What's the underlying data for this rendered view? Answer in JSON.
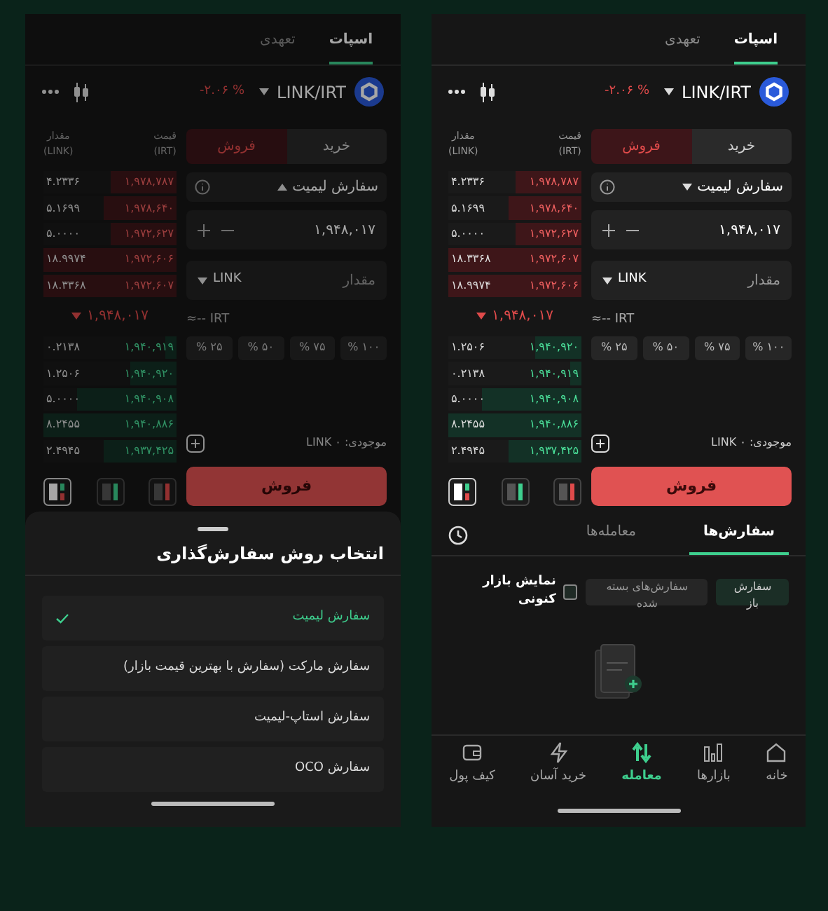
{
  "left_phone": {
    "trade": {
      "tabs": [
        {
          "label": "اسپات",
          "selected": true
        },
        {
          "label": "تعهدی",
          "selected": false
        }
      ],
      "pair": "LINK/IRT",
      "change": "-۲.۰۶ %",
      "side_tabs": [
        {
          "label": "خرید",
          "kind": "buy",
          "selected": false
        },
        {
          "label": "فروش",
          "kind": "sell",
          "selected": true
        }
      ],
      "book_headers": [
        {
          "label": "قیمت",
          "unit": "(IRT)"
        },
        {
          "label": "مقدار",
          "unit": "(LINK)"
        }
      ],
      "asks": [
        {
          "price": "۱,۹۷۸,۷۸۷",
          "amount": "۴.۲۳۳۶",
          "level": 0.5
        },
        {
          "price": "۱,۹۷۸,۶۴۰",
          "amount": "۵.۱۶۹۹",
          "level": 0.55
        },
        {
          "price": "۱,۹۷۲,۶۲۷",
          "amount": "۵.۰۰۰۰",
          "level": 0.5
        },
        {
          "price": "۱,۹۷۲,۶۰۶",
          "amount": "۱۸.۹۹۷۴",
          "level": 1
        },
        {
          "price": "۱,۹۷۲,۶۰۷",
          "amount": "۱۸.۳۳۶۸",
          "level": 1
        }
      ],
      "last_price": "۱,۹۴۸,۰۱۷",
      "irt_estimate": "≈-- IRT",
      "bids": [
        {
          "price": "۱,۹۴۰,۹۱۹",
          "amount": "۰.۲۱۳۸",
          "level": 0.08
        },
        {
          "price": "۱,۹۴۰,۹۲۰",
          "amount": "۱.۲۵۰۶",
          "level": 0.35
        },
        {
          "price": "۱,۹۴۰,۹۰۸",
          "amount": "۵.۰۰۰۰",
          "level": 0.75
        },
        {
          "price": "۱,۹۴۰,۸۸۶",
          "amount": "۸.۲۴۵۵",
          "level": 1
        },
        {
          "price": "۱,۹۳۷,۴۲۵",
          "amount": "۲.۴۹۴۵",
          "level": 0.55
        }
      ],
      "order_type": {
        "label": "سفارش لیمیت",
        "expanded": true
      },
      "price_value": "۱,۹۴۸,۰۱۷",
      "amount_placeholder": "مقدار",
      "amount_unit": "LINK",
      "percents": [
        "۱۰۰ %",
        "۷۵ %",
        "۵۰ %",
        "۲۵ %"
      ],
      "balance_label": "موجودی:",
      "balance_value": "LINK ۰",
      "submit": "فروش"
    },
    "sheet": {
      "title": "انتخاب روش سفارش‌گذاری",
      "options": [
        {
          "label": "سفارش لیمیت",
          "selected": true
        },
        {
          "label": "سفارش مارکت (سفارش با بهترین قیمت بازار)",
          "selected": false
        },
        {
          "label": "سفارش استاپ-لیمیت",
          "selected": false
        },
        {
          "label": "سفارش OCO",
          "selected": false
        }
      ]
    }
  },
  "right_phone": {
    "trade": {
      "tabs": [
        {
          "label": "اسپات",
          "selected": true
        },
        {
          "label": "تعهدی",
          "selected": false
        }
      ],
      "pair": "LINK/IRT",
      "change": "-۲.۰۶ %",
      "side_tabs": [
        {
          "label": "خرید",
          "kind": "buy",
          "selected": false
        },
        {
          "label": "فروش",
          "kind": "sell",
          "selected": true
        }
      ],
      "book_headers": [
        {
          "label": "قیمت",
          "unit": "(IRT)"
        },
        {
          "label": "مقدار",
          "unit": "(LINK)"
        }
      ],
      "asks": [
        {
          "price": "۱,۹۷۸,۷۸۷",
          "amount": "۴.۲۳۳۶",
          "level": 0.5
        },
        {
          "price": "۱,۹۷۸,۶۴۰",
          "amount": "۵.۱۶۹۹",
          "level": 0.55
        },
        {
          "price": "۱,۹۷۲,۶۲۷",
          "amount": "۵.۰۰۰۰",
          "level": 0.5
        },
        {
          "price": "۱,۹۷۲,۶۰۷",
          "amount": "۱۸.۳۳۶۸",
          "level": 1
        },
        {
          "price": "۱,۹۷۲,۶۰۶",
          "amount": "۱۸.۹۹۷۴",
          "level": 1
        }
      ],
      "last_price": "۱,۹۴۸,۰۱۷",
      "irt_estimate": "≈-- IRT",
      "bids": [
        {
          "price": "۱,۹۴۰,۹۲۰",
          "amount": "۱.۲۵۰۶",
          "level": 0.35
        },
        {
          "price": "۱,۹۴۰,۹۱۹",
          "amount": "۰.۲۱۳۸",
          "level": 0.08
        },
        {
          "price": "۱,۹۴۰,۹۰۸",
          "amount": "۵.۰۰۰۰",
          "level": 0.75
        },
        {
          "price": "۱,۹۴۰,۸۸۶",
          "amount": "۸.۲۴۵۵",
          "level": 1
        },
        {
          "price": "۱,۹۳۷,۴۲۵",
          "amount": "۲.۴۹۴۵",
          "level": 0.55
        }
      ],
      "order_type": {
        "label": "سفارش لیمیت",
        "expanded": false
      },
      "price_value": "۱,۹۴۸,۰۱۷",
      "amount_placeholder": "مقدار",
      "amount_unit": "LINK",
      "percents": [
        "۱۰۰ %",
        "۷۵ %",
        "۵۰ %",
        "۲۵ %"
      ],
      "balance_label": "موجودی:",
      "balance_value": "LINK ۰",
      "submit": "فروش"
    },
    "orders": {
      "tabs": [
        {
          "label": "سفارش‌ها",
          "selected": true
        },
        {
          "label": "معامله‌ها",
          "selected": false
        }
      ],
      "filters": [
        {
          "label": "سفارش باز",
          "selected": true
        },
        {
          "label": "سفارش‌های بسته شده",
          "selected": false
        }
      ],
      "current_market": {
        "label": "نمایش بازار کنونی",
        "checked": false
      }
    },
    "nav": [
      {
        "label": "خانه",
        "kind": "home",
        "selected": false
      },
      {
        "label": "بازارها",
        "kind": "markets",
        "selected": false
      },
      {
        "label": "معامله",
        "kind": "trade",
        "selected": true
      },
      {
        "label": "خرید آسان",
        "kind": "easy",
        "selected": false
      },
      {
        "label": "کیف پول",
        "kind": "wallet",
        "selected": false
      }
    ]
  }
}
